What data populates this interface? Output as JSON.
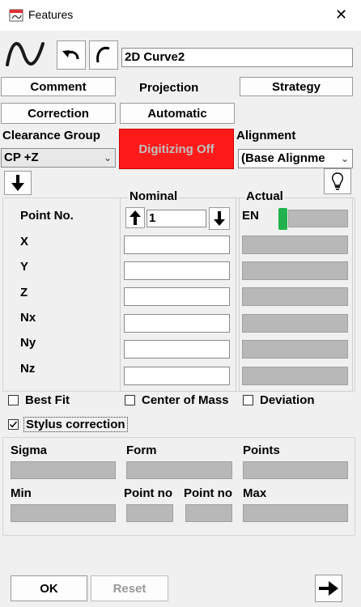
{
  "window": {
    "title": "Features",
    "close_glyph": "✕"
  },
  "toolbar": {
    "feature_name": "2D Curve2"
  },
  "buttons": {
    "comment": "Comment",
    "projection": "Projection",
    "strategy": "Strategy",
    "correction": "Correction",
    "automatic": "Automatic",
    "digitizing": "Digitizing Off",
    "ok": "OK",
    "reset": "Reset"
  },
  "clearance": {
    "label": "Clearance Group",
    "value": "CP +Z"
  },
  "alignment": {
    "label": "Alignment",
    "value": "(Base Alignme"
  },
  "grid": {
    "nominal_label": "Nominal",
    "actual_label": "Actual",
    "point_no_label": "Point No.",
    "point_no_value": "1",
    "en_label": "EN",
    "rows": [
      "X",
      "Y",
      "Z",
      "Nx",
      "Ny",
      "Nz"
    ]
  },
  "options": {
    "best_fit": "Best Fit",
    "center_of_mass": "Center of Mass",
    "deviation": "Deviation",
    "stylus_correction": "Stylus correction",
    "stylus_checked": true
  },
  "stats": {
    "sigma": "Sigma",
    "form": "Form",
    "points": "Points",
    "min": "Min",
    "point_no_1": "Point no",
    "point_no_2": "Point no",
    "max": "Max"
  },
  "colors": {
    "digitizing_bg": "#ff1a1a",
    "en_indicator": "#22b14c"
  },
  "icons": [
    "app-icon",
    "close-icon",
    "curve-icon",
    "undo-icon",
    "arc-icon",
    "arrow-down-icon",
    "lightbulb-icon",
    "arrow-up-icon",
    "arrow-right-icon",
    "chevron-down-icon"
  ]
}
